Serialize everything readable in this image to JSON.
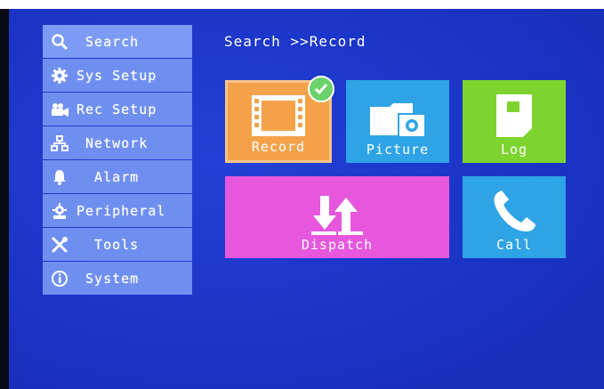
{
  "sidebar": {
    "items": [
      {
        "label": " Search",
        "icon": "search-icon"
      },
      {
        "label": "Sys Setup",
        "icon": "gear-icon"
      },
      {
        "label": "Rec Setup",
        "icon": "camera-icon"
      },
      {
        "label": " Network",
        "icon": "network-icon"
      },
      {
        "label": "  Alarm",
        "icon": "bell-icon"
      },
      {
        "label": "Peripheral",
        "icon": "peripheral-icon"
      },
      {
        "label": "  Tools",
        "icon": "tools-icon"
      },
      {
        "label": " System",
        "icon": "info-icon"
      }
    ],
    "active_index": 0
  },
  "breadcrumb": "Search >>Record",
  "tiles": {
    "record": {
      "label": "Record",
      "color": "#f3a24a",
      "selected": true
    },
    "picture": {
      "label": "Picture",
      "color": "#2ea4e6"
    },
    "log": {
      "label": "Log",
      "color": "#7ed42e"
    },
    "dispatch": {
      "label": "Dispatch",
      "color": "#e657de"
    },
    "call": {
      "label": "Call",
      "color": "#2ea4e6"
    }
  },
  "colors": {
    "background": "#1c36cc",
    "sidebar_item": "#6f8ff0"
  }
}
